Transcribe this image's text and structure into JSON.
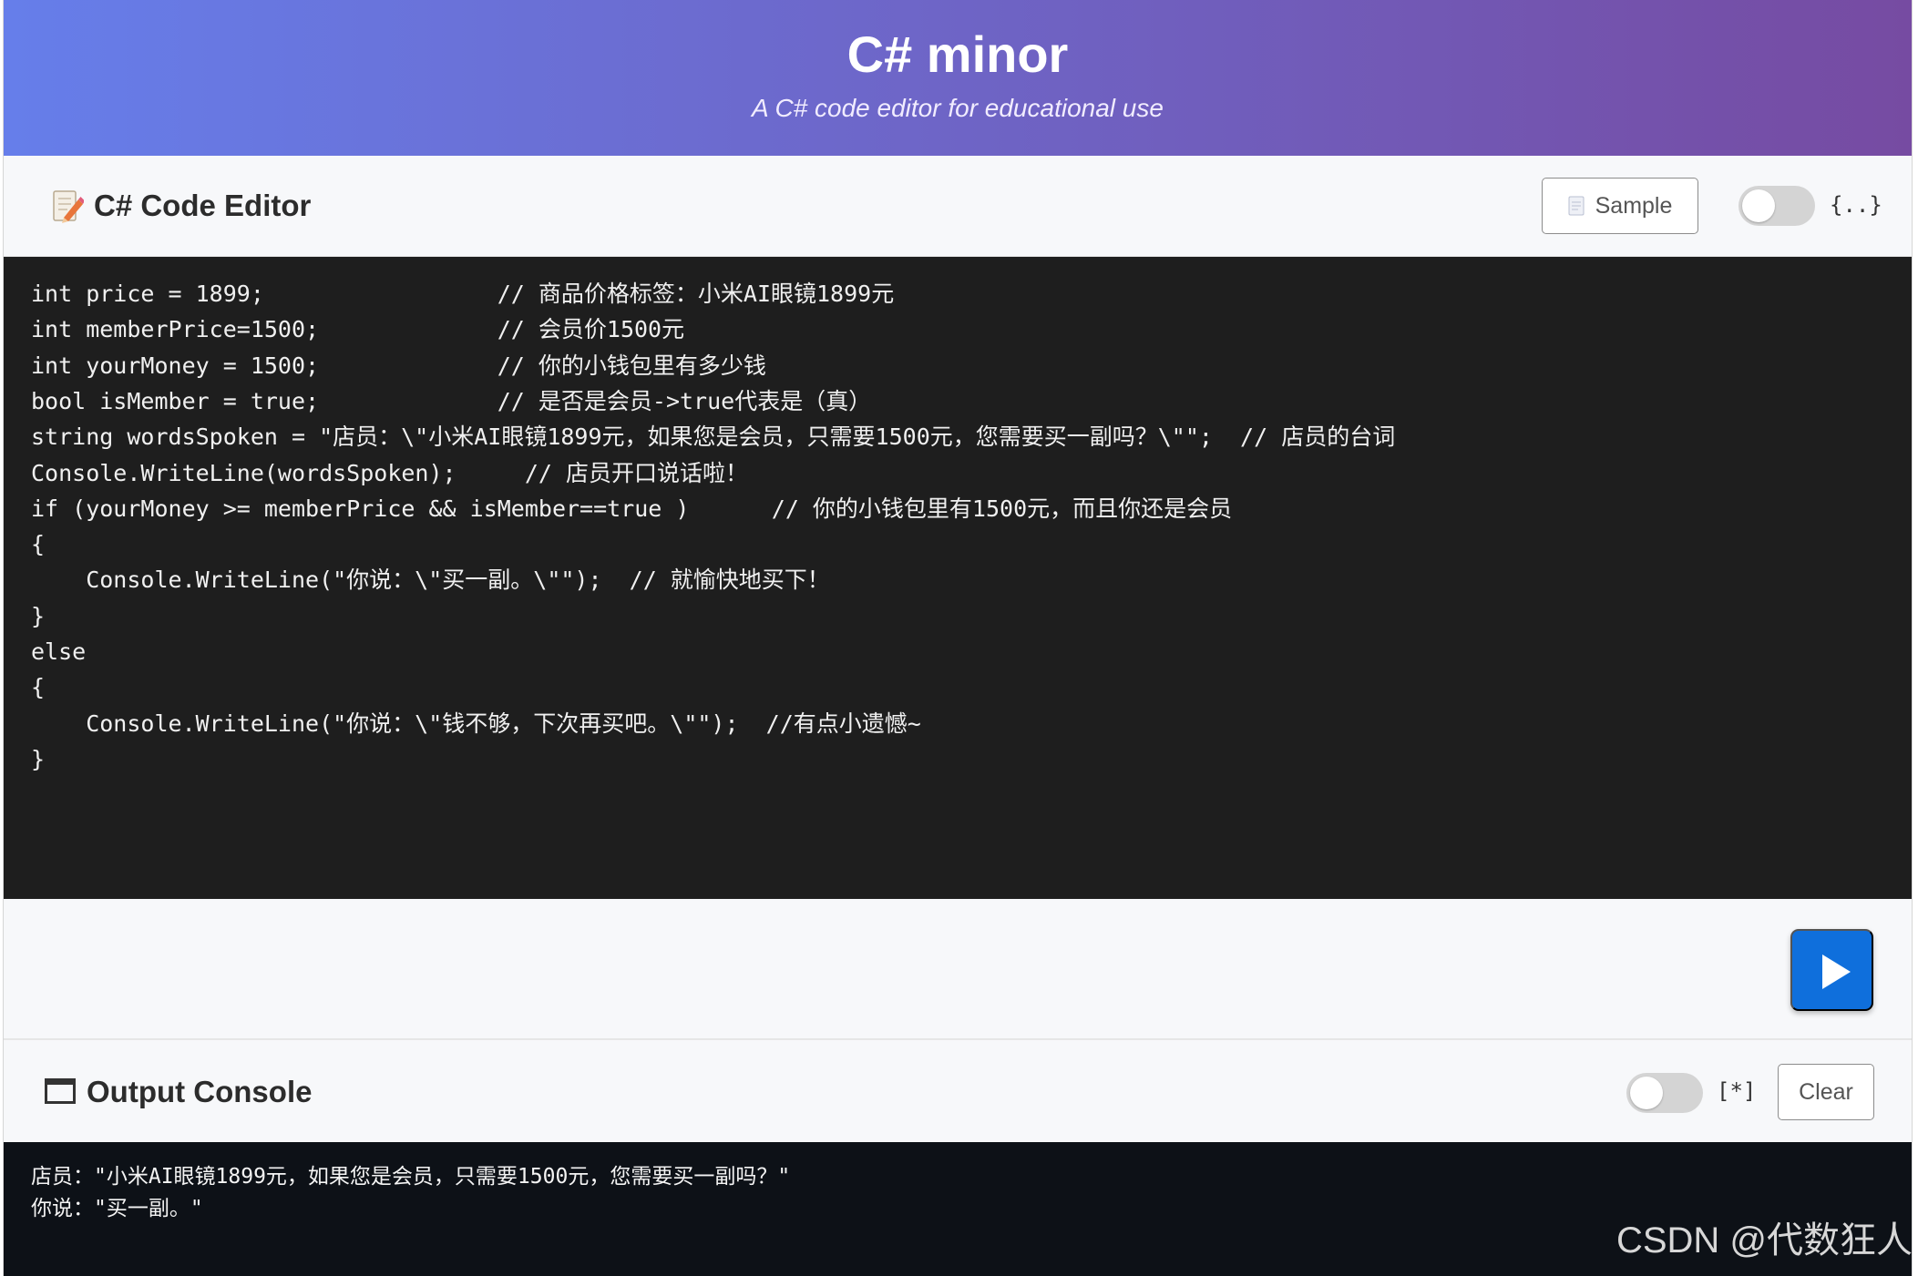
{
  "header": {
    "title": "C# minor",
    "subtitle": "A C# code editor for educational use"
  },
  "editor": {
    "icon": "memo-pencil-icon",
    "title": "C# Code Editor",
    "sample_button": "Sample",
    "sample_icon": "document-icon",
    "format_toggle_label": "{..}",
    "format_toggle_on": false,
    "code_lines": [
      "int price = 1899;                 // 商品价格标签：小米AI眼镜1899元",
      "int memberPrice=1500;             // 会员价1500元",
      "int yourMoney = 1500;             // 你的小钱包里有多少钱",
      "bool isMember = true;             // 是否是会员->true代表是（真）",
      "string wordsSpoken = \"店员：\\\"小米AI眼镜1899元，如果您是会员，只需要1500元，您需要买一副吗？\\\"\";  // 店员的台词",
      "Console.WriteLine(wordsSpoken);     // 店员开口说话啦！",
      "if (yourMoney >= memberPrice && isMember==true )      // 你的小钱包里有1500元，而且你还是会员",
      "{",
      "    Console.WriteLine(\"你说：\\\"买一副。\\\"\");  // 就愉快地买下！",
      "}",
      "else",
      "{",
      "    Console.WriteLine(\"你说：\\\"钱不够，下次再买吧。\\\"\");  //有点小遗憾~",
      "}"
    ]
  },
  "run": {
    "icon": "play-icon",
    "color": "#0f6fdc"
  },
  "output": {
    "icon": "window-icon",
    "title": "Output Console",
    "toggle_label": "[*]",
    "toggle_on": false,
    "clear_button": "Clear",
    "lines": [
      "店员：\"小米AI眼镜1899元，如果您是会员，只需要1500元，您需要买一副吗？\"",
      "你说：\"买一副。\""
    ]
  },
  "watermark": "CSDN @代数狂人",
  "colors": {
    "header_gradient_start": "#667eea",
    "header_gradient_end": "#764ba2",
    "editor_bg": "#1e1e1e",
    "console_bg": "#0d1117"
  }
}
